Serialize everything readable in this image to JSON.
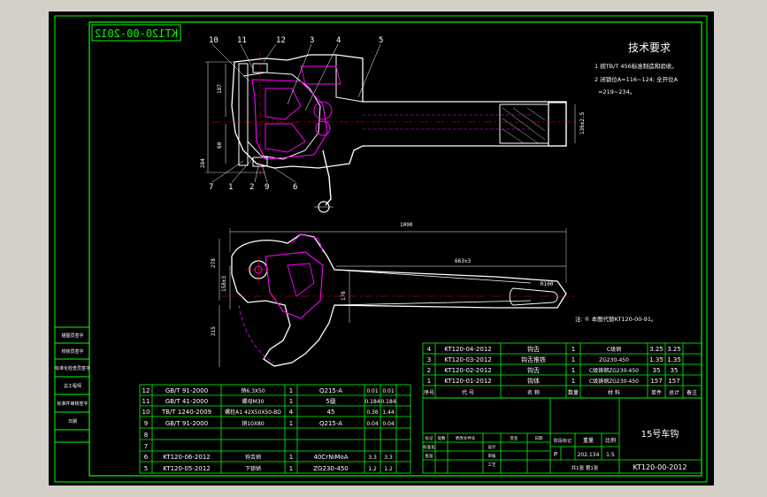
{
  "viewer": {
    "bg_color": "#d4d0c8",
    "canvas_color": "#000000",
    "line_color": "#00ff00",
    "part_color": "#ffffff",
    "hidden_color": "#ff00ff",
    "dim_color": "#ffffff"
  },
  "drawing": {
    "mirrored_code": "KT120-00-2012",
    "callouts": [
      "10",
      "11",
      "12",
      "3",
      "4",
      "5",
      "7",
      "1",
      "9",
      "6",
      "2"
    ],
    "dims": {
      "d187": "187",
      "d60": "60",
      "d284": "284",
      "d136": "136±2.5",
      "d1090": "1090",
      "d663": "663±3",
      "d278": "278",
      "d158": "158±3",
      "d176": "176",
      "d215": "215",
      "dR": "R100"
    },
    "note": "注: ① 本图代替KT120-00-91。"
  },
  "tech": {
    "title": "技术要求",
    "line1": "1  按TB/T 456标准制造和验收。",
    "line2": "2  闭锁位A=116~124; 全开位A",
    "line3": "=219~234。"
  },
  "side_labels": [
    "描图员签字",
    "校核员签字",
    "标准化检查员签字",
    "总工程师",
    "标准件审核签字",
    "日期"
  ],
  "bom": {
    "upper": [
      {
        "no": "4",
        "code": "KT120-04-2012",
        "name": "钩舌",
        "qty": "1",
        "mat": "C级钢",
        "w1": "3.25",
        "w2": "3.25"
      },
      {
        "no": "3",
        "code": "KT120-03-2012",
        "name": "钩舌推铁",
        "qty": "1",
        "mat": "ZG230-450",
        "w1": "1.35",
        "w2": "1.35"
      },
      {
        "no": "2",
        "code": "KT120-02-2012",
        "name": "钩舌",
        "qty": "1",
        "mat": "C级铸钢ZG230-450",
        "w1": "35",
        "w2": "35"
      },
      {
        "no": "1",
        "code": "KT120-01-2012",
        "name": "钩体",
        "qty": "1",
        "mat": "C级铸钢ZG230-450",
        "w1": "157",
        "w2": "157"
      }
    ],
    "upper_header": {
      "no": "序号",
      "code": "代  号",
      "name": "名  称",
      "qty": "数量",
      "mat": "材  料",
      "w1": "单件",
      "w2": "总计",
      "remark": "备注"
    },
    "lower": [
      {
        "no": "12",
        "code": "GB/T 91-2000",
        "name": "销6.3X50",
        "qty": "1",
        "mat": "Q215-A",
        "w1": "0.01",
        "w2": "0.01"
      },
      {
        "no": "11",
        "code": "GB/T 41-2000",
        "name": "螺母M30",
        "qty": "1",
        "mat": "5级",
        "w1": "0.184",
        "w2": "0.184"
      },
      {
        "no": "10",
        "code": "TB/T 1240-2009",
        "name": "螺栓A1 42X50X50-BD",
        "qty": "4",
        "mat": "45",
        "w1": "0.36",
        "w2": "1.44"
      },
      {
        "no": "9",
        "code": "GB/T 91-2000",
        "name": "销10X80",
        "qty": "1",
        "mat": "Q215-A",
        "w1": "0.04",
        "w2": "0.04"
      },
      {
        "no": "8",
        "code": "",
        "name": "",
        "qty": "",
        "mat": "",
        "w1": "",
        "w2": ""
      },
      {
        "no": "7",
        "code": "",
        "name": "",
        "qty": "",
        "mat": "",
        "w1": "",
        "w2": ""
      },
      {
        "no": "6",
        "code": "KT120-06-2012",
        "name": "钩舌销",
        "qty": "1",
        "mat": "40CrNiMoA",
        "w1": "3.3",
        "w2": "3.3"
      },
      {
        "no": "5",
        "code": "KT120-05-2012",
        "name": "下锁销",
        "qty": "1",
        "mat": "ZG230-450",
        "w1": "1.2",
        "w2": "1.2"
      }
    ],
    "title_name": "15号车钩",
    "drawing_no": "KT120-00-2012",
    "stage_label": "阶段标记",
    "weight_label": "重量",
    "scale_label": "比例",
    "stage": "P",
    "weight": "202.134",
    "scale": "1:5",
    "sheet": "共1张  第1张",
    "rev_labels": [
      "标记",
      "处数",
      "更改文件号",
      "签名",
      "日期"
    ],
    "role_labels": [
      "设计",
      "审核",
      "工艺",
      "标准化",
      "批准"
    ]
  }
}
